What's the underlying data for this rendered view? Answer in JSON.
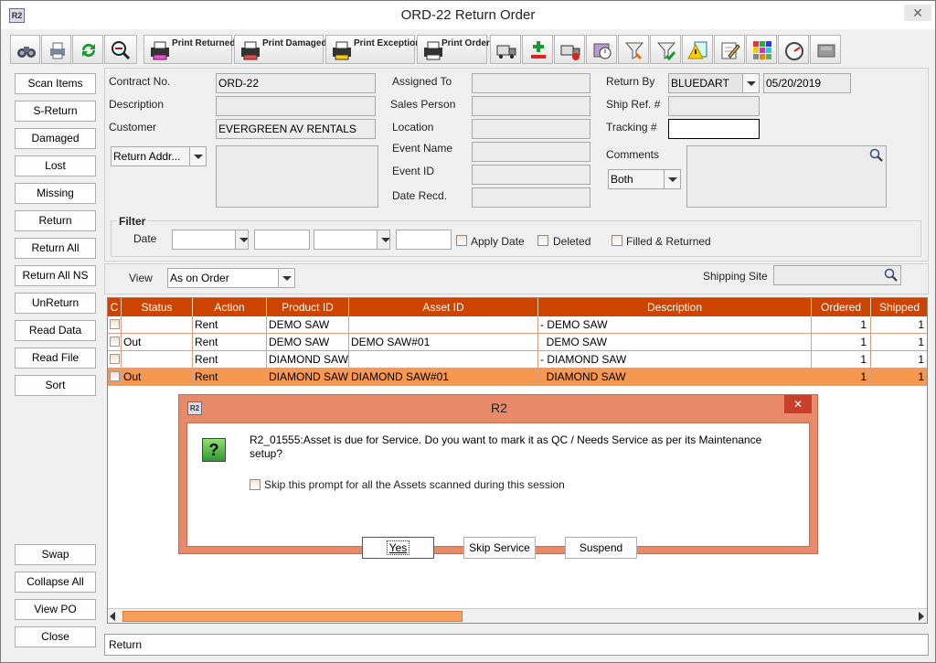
{
  "window": {
    "title": "ORD-22 Return Order",
    "icon": "R2",
    "close": "✕"
  },
  "toolbar": [
    {
      "name": "binoculars-icon"
    },
    {
      "name": "print-icon"
    },
    {
      "name": "refresh-icon"
    },
    {
      "name": "zoom-icon"
    },
    {
      "name": "print-returned-button",
      "label": "Print Returned"
    },
    {
      "name": "print-damaged-button",
      "label": "Print Damaged"
    },
    {
      "name": "print-exception-button",
      "label": "Print Exception"
    },
    {
      "name": "print-order-list-button",
      "label": "Print Order List"
    },
    {
      "name": "truck-icon"
    },
    {
      "name": "add-remove-icon"
    },
    {
      "name": "truck-alert-icon"
    },
    {
      "name": "clock-icon"
    },
    {
      "name": "funnel-icon"
    },
    {
      "name": "filter-check-icon"
    },
    {
      "name": "warning-icon"
    },
    {
      "name": "edit-icon"
    },
    {
      "name": "grid-icon"
    },
    {
      "name": "gauge-icon"
    },
    {
      "name": "disk-icon"
    }
  ],
  "side_buttons": [
    "Scan Items",
    "S-Return",
    "Damaged",
    "Lost",
    "Missing",
    "Return",
    "Return All",
    "Return All NS",
    "UnReturn",
    "Read Data",
    "Read File",
    "Sort"
  ],
  "side_buttons_bottom": [
    "Swap",
    "Collapse All",
    "View PO",
    "Close"
  ],
  "form": {
    "contract_label": "Contract No.",
    "contract_value": "ORD-22",
    "description_label": "Description",
    "description_value": "",
    "customer_label": "Customer",
    "customer_value": "EVERGREEN AV RENTALS",
    "return_addr": "Return Addr...",
    "assigned_to_label": "Assigned To",
    "sales_person_label": "Sales Person",
    "location_label": "Location",
    "event_name_label": "Event Name",
    "event_id_label": "Event ID",
    "date_recd_label": "Date Recd.",
    "return_by_label": "Return By",
    "return_by_value": "BLUEDART",
    "return_by_date": "05/20/2019",
    "ship_ref_label": "Ship Ref. #",
    "tracking_label": "Tracking #",
    "comments_label": "Comments",
    "comments_scope": "Both"
  },
  "filter": {
    "title": "Filter",
    "date_label": "Date",
    "apply_date": "Apply Date",
    "deleted": "Deleted",
    "filled_returned": "Filled & Returned"
  },
  "view": {
    "label": "View",
    "value": "As on Order",
    "shipping_site_label": "Shipping Site"
  },
  "grid": {
    "headers": [
      "C",
      "Status",
      "Action",
      "Product ID",
      "Asset ID",
      "Description",
      "Ordered",
      "Shipped"
    ],
    "rows": [
      {
        "status": "",
        "action": "Rent",
        "product": "DEMO SAW",
        "asset": "",
        "desc": "- DEMO SAW",
        "ordered": "1",
        "shipped": "1"
      },
      {
        "status": "Out",
        "action": "Rent",
        "product": "DEMO SAW",
        "asset": "DEMO SAW#01",
        "desc": "  DEMO SAW",
        "ordered": "1",
        "shipped": "1"
      },
      {
        "status": "",
        "action": "Rent",
        "product": "DIAMOND SAW",
        "asset": "",
        "desc": "- DIAMOND SAW",
        "ordered": "1",
        "shipped": "1"
      },
      {
        "status": "Out",
        "action": "Rent",
        "product": "DIAMOND SAW",
        "asset": "DIAMOND SAW#01",
        "desc": "  DIAMOND SAW",
        "ordered": "1",
        "shipped": "1"
      }
    ]
  },
  "status_bar": "Return",
  "dialog": {
    "title": "R2",
    "icon": "?",
    "message": "R2_01555:Asset is due for Service. Do you want to mark it as QC / Needs Service as per its Maintenance setup?",
    "skip_prompt": "Skip this prompt for all the Assets scanned during this session",
    "yes": "Yes",
    "skip_service": "Skip Service",
    "suspend": "Suspend"
  },
  "colors": {
    "grid_header": "#cc4400",
    "selected_row": "#f79850",
    "dialog_frame": "#e8896a"
  }
}
